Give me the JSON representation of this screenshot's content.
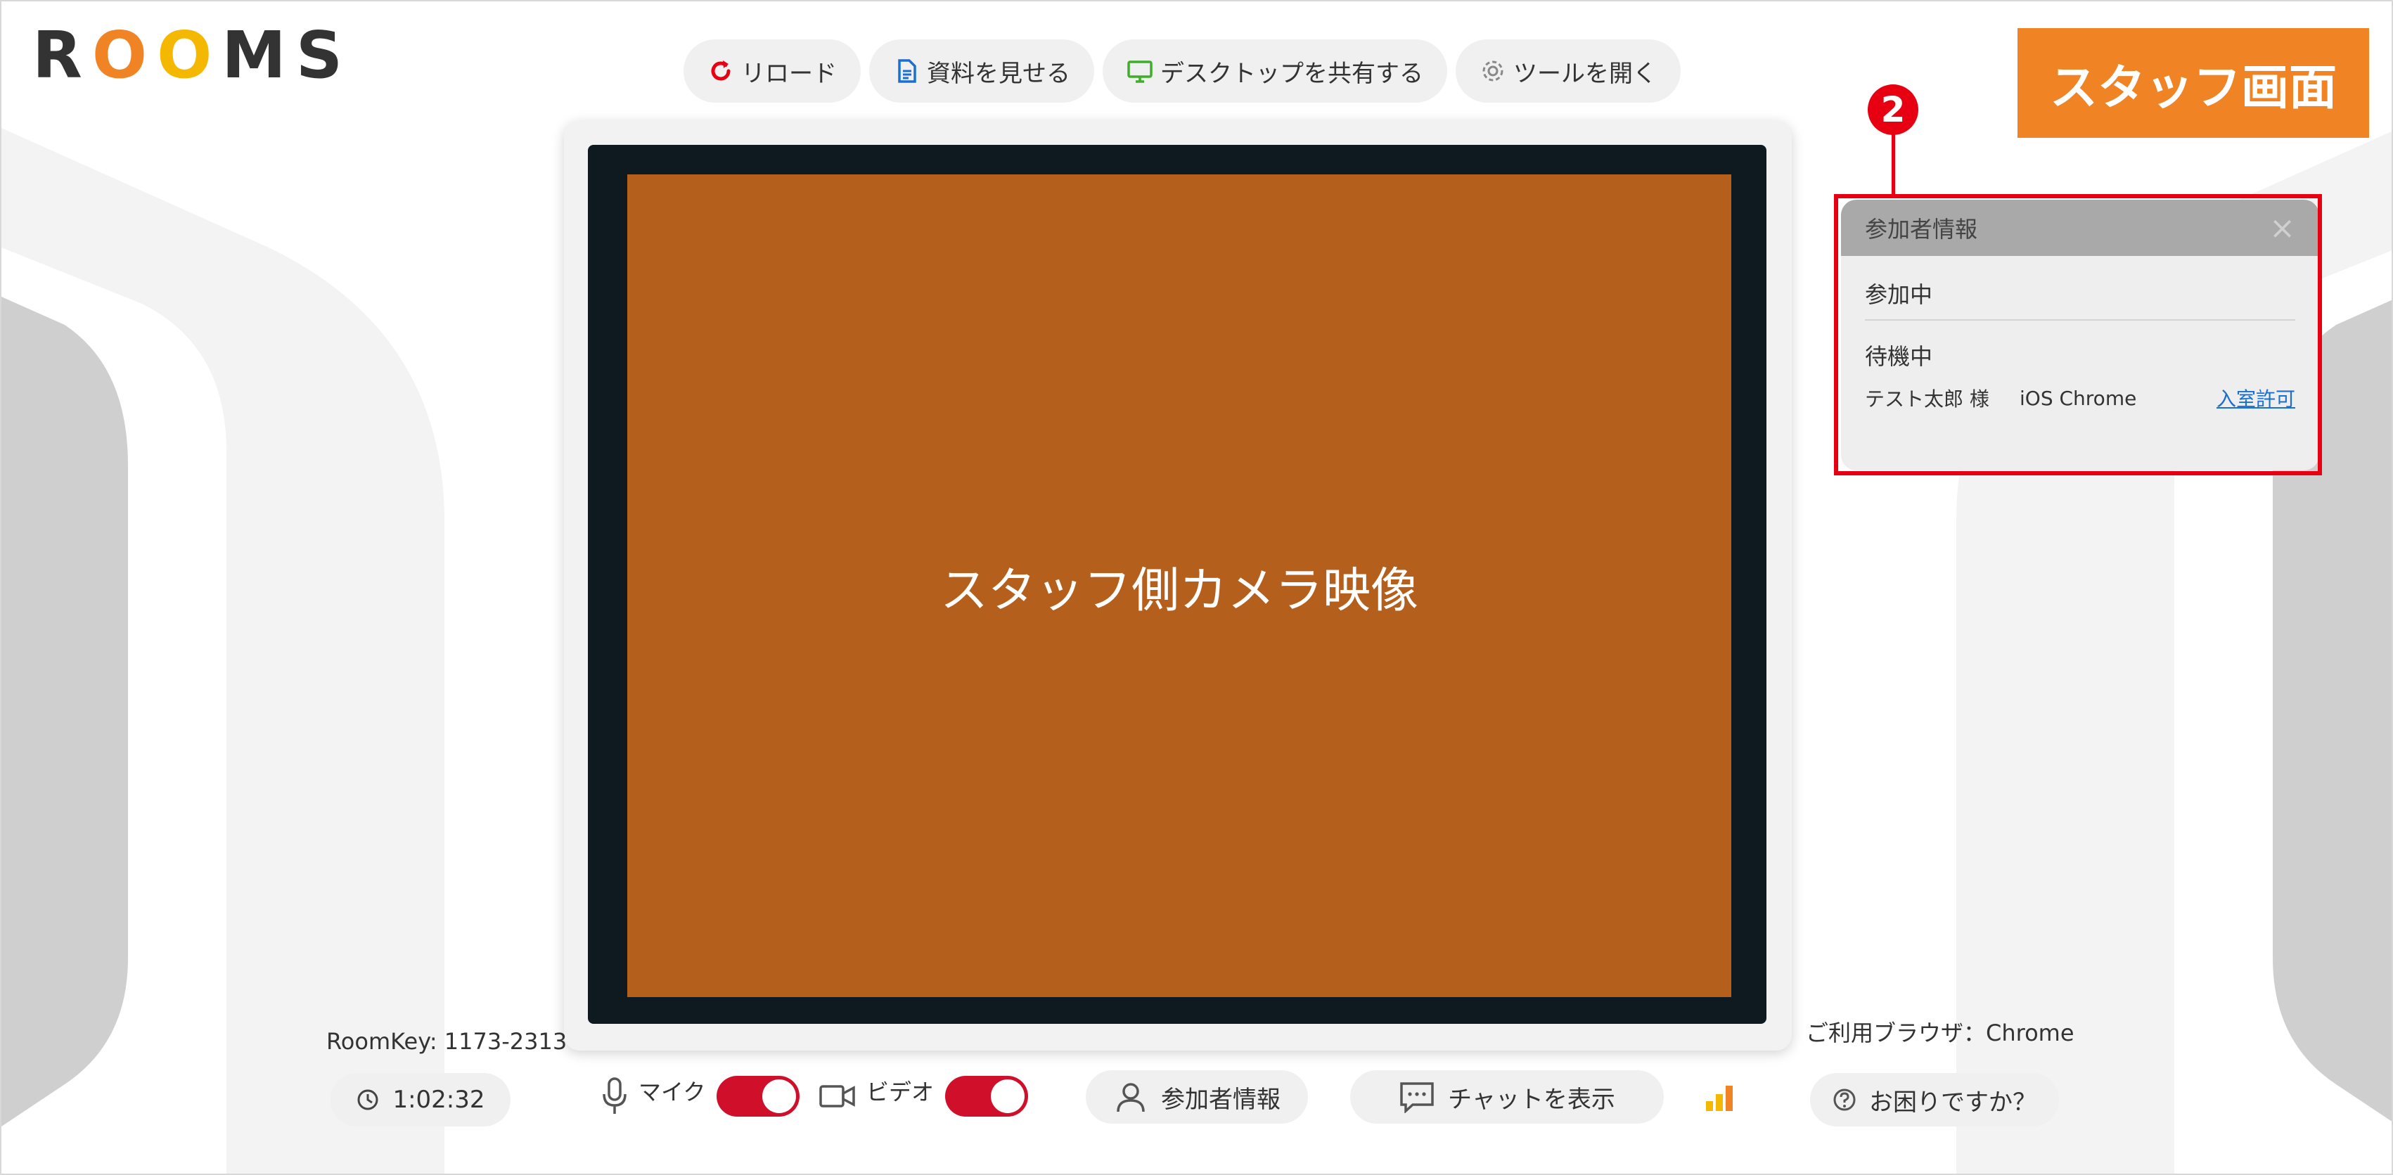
{
  "logo": {
    "letters": [
      "R",
      "O",
      "O",
      "M",
      "S"
    ],
    "colors": [
      "#333333",
      "#f08324",
      "#f5b800",
      "#333333",
      "#333333"
    ]
  },
  "toolbar": {
    "items": [
      {
        "label": "リロード",
        "icon": "reload-icon",
        "color": "#e60012"
      },
      {
        "label": "資料を見せる",
        "icon": "document-icon",
        "color": "#1a6fd1"
      },
      {
        "label": "デスクトップを共有する",
        "icon": "monitor-icon",
        "color": "#3fae2a"
      },
      {
        "label": "ツールを開く",
        "icon": "gear-icon",
        "color": "#888888"
      }
    ]
  },
  "staff_label": "スタッフ画面",
  "video": {
    "caption": "スタッフ側カメラ映像"
  },
  "annotation": {
    "number": "2"
  },
  "participant_panel": {
    "title": "参加者情報",
    "close": "×",
    "active_label": "参加中",
    "waiting_label": "待機中",
    "waiting": [
      {
        "name": "テスト太郎 様",
        "browser": "iOS Chrome",
        "action": "入室許可"
      }
    ]
  },
  "bottom": {
    "roomkey": "RoomKey: 1173-2313",
    "timer": "1:02:32",
    "mic_label": "マイク",
    "video_label": "ビデオ",
    "participants_label": "参加者情報",
    "chat_label": "チャットを表示",
    "browser_info": "ご利用ブラウザ：Chrome",
    "help_label": "お困りですか？",
    "mic_on": true,
    "video_on": true
  },
  "colors": {
    "accent": "#f08324",
    "toggle_on": "#d0102a",
    "annotation": "#e60012",
    "video_bg": "#b55f1d"
  }
}
